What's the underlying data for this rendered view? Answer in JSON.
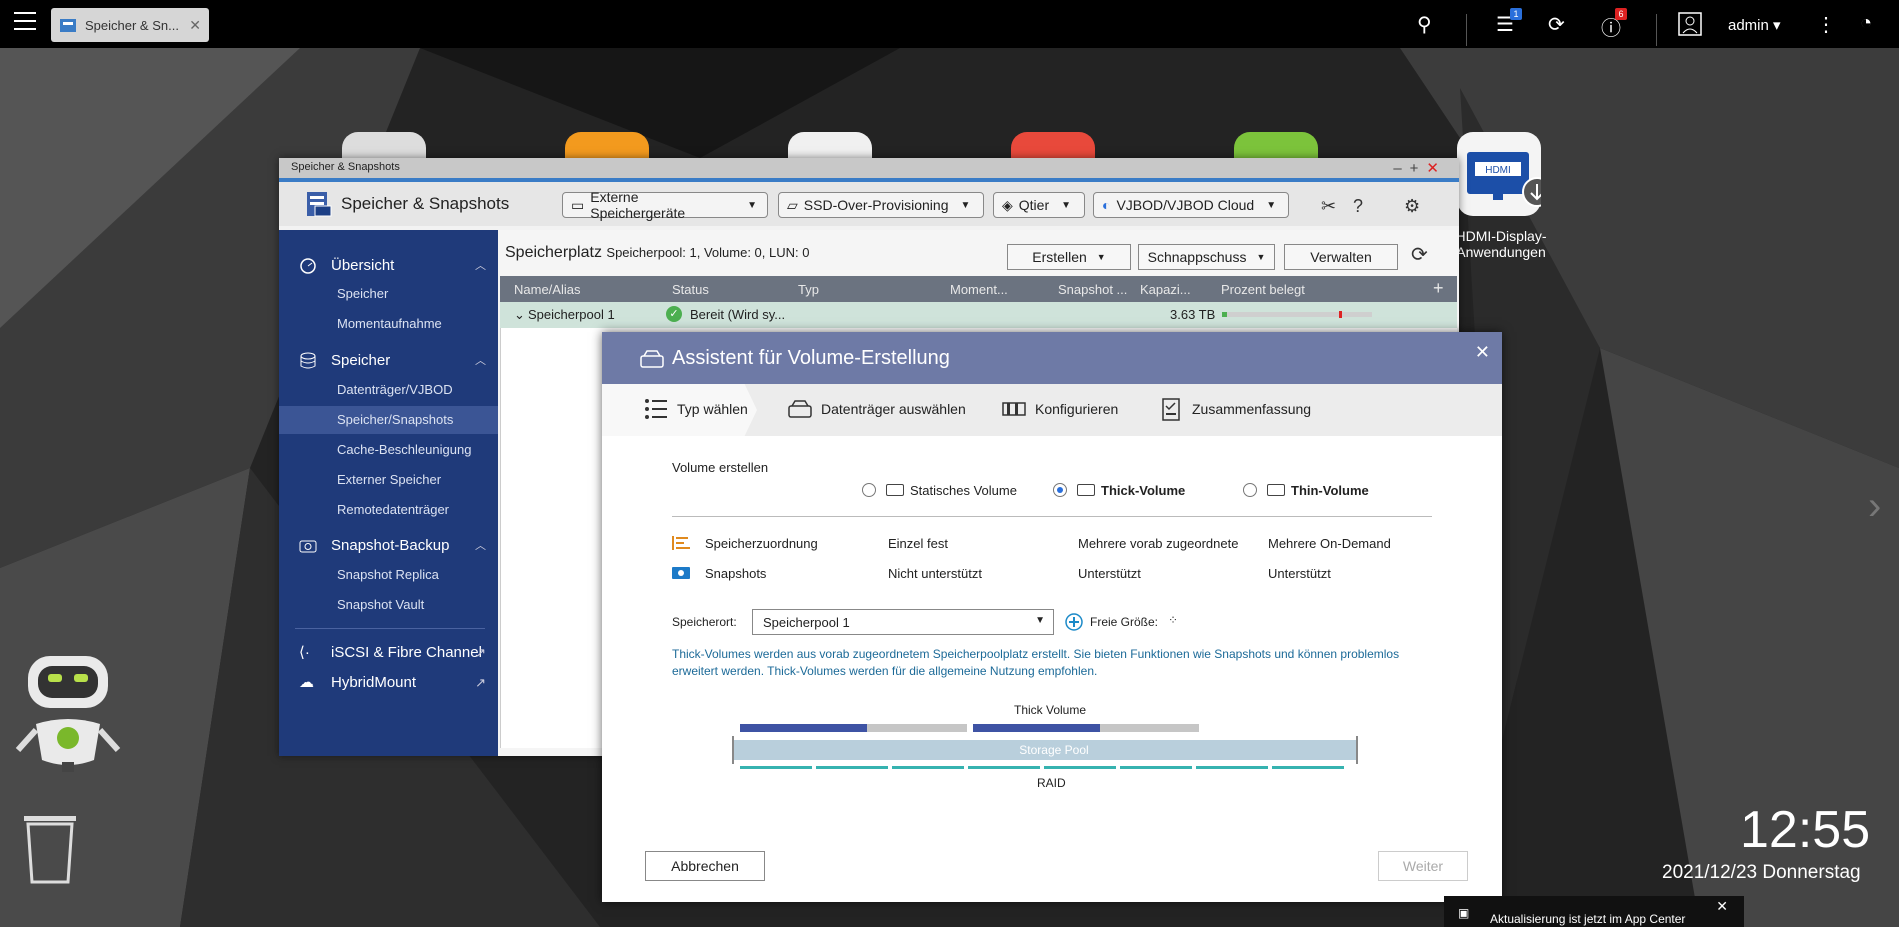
{
  "taskbar": {
    "tab_label": "Speicher & Sn...",
    "badges": {
      "tasks": "1",
      "notifications": "6"
    },
    "user": "admin"
  },
  "desktop": {
    "hdmi_label_line1": "HDMI-Display-",
    "hdmi_label_line2": "Anwendungen",
    "clock": "12:55",
    "date": "2021/12/23 Donnerstag",
    "notification": "Aktualisierung ist jetzt im App Center"
  },
  "window": {
    "titlebar": "Speicher & Snapshots",
    "app_title": "Speicher & Snapshots",
    "header_buttons": [
      "Externe Speichergeräte",
      "SSD-Over-Provisioning",
      "Qtier",
      "VJBOD/VJBOD Cloud"
    ],
    "sidebar": {
      "overview": "Übersicht",
      "overview_items": [
        "Speicher",
        "Momentaufnahme"
      ],
      "storage": "Speicher",
      "storage_items": [
        "Datenträger/VJBOD",
        "Speicher/Snapshots",
        "Cache-Beschleunigung",
        "Externer Speicher",
        "Remotedatenträger"
      ],
      "backup": "Snapshot-Backup",
      "backup_items": [
        "Snapshot Replica",
        "Snapshot Vault"
      ],
      "iscsi": "iSCSI & Fibre Channel",
      "hybrid": "HybridMount"
    },
    "content": {
      "title": "Speicherplatz",
      "subtitle": "Speicherpool: 1, Volume: 0, LUN: 0",
      "buttons": {
        "create": "Erstellen",
        "snapshot": "Schnappschuss",
        "manage": "Verwalten"
      },
      "columns": [
        "Name/Alias",
        "Status",
        "Typ",
        "Moment...",
        "Snapshot ...",
        "Kapazi...",
        "Prozent belegt"
      ],
      "row": {
        "name": "Speicherpool 1",
        "status": "Bereit (Wird sy...",
        "capacity": "3.63 TB"
      }
    }
  },
  "wizard": {
    "title": "Assistent für Volume-Erstellung",
    "steps": [
      "Typ wählen",
      "Datenträger auswählen",
      "Konfigurieren",
      "Zusammenfassung"
    ],
    "create_label": "Volume erstellen",
    "types": [
      "Statisches Volume",
      "Thick-Volume",
      "Thin-Volume"
    ],
    "selected_type": "Thick-Volume",
    "features": [
      {
        "label": "Speicherzuordnung",
        "values": [
          "Einzel fest",
          "Mehrere vorab zugeordnete",
          "Mehrere On-Demand"
        ]
      },
      {
        "label": "Snapshots",
        "values": [
          "Nicht unterstützt",
          "Unterstützt",
          "Unterstützt"
        ]
      }
    ],
    "location_label": "Speicherort:",
    "location_value": "Speicherpool 1",
    "free_size_label": "Freie Größe:",
    "description": "Thick-Volumes werden aus vorab zugeordnetem Speicherpoolplatz erstellt. Sie bieten Funktionen wie Snapshots und können problemlos erweitert werden. Thick-Volumes werden für die allgemeine Nutzung empfohlen.",
    "diagram": {
      "top_label": "Thick Volume",
      "pool_label": "Storage Pool",
      "bottom_label": "RAID"
    },
    "cancel": "Abbrechen",
    "next": "Weiter"
  }
}
